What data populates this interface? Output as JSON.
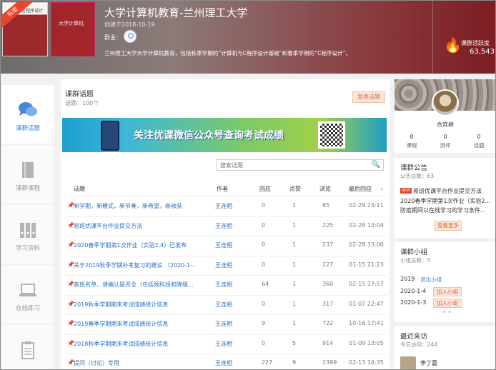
{
  "header": {
    "private_ribbon": "私密",
    "cover1_text": "高级语言程序设计",
    "cover2_text": "大学计算机",
    "course_title": "大学计算机教育-兰州理工大学",
    "created": "创建于2018-10-19",
    "owner_label": "群主：",
    "description": "兰州理工大学大学计算机教育，包括秋季学期的“计算机与C程序设计基础”和春季学期的“C程序设计”。",
    "activity_label": "课群活跃度",
    "activity_value": "63,543",
    "brand_colors": {
      "header_dark": "#7b1d22",
      "accent": "#3f82d6",
      "orange": "#e06c3c"
    }
  },
  "nav": {
    "items": [
      {
        "label": "课群话题",
        "icon": "chat-bubbles-icon",
        "active": true
      },
      {
        "label": "课群课程",
        "icon": "book-icon",
        "active": false
      },
      {
        "label": "学习资料",
        "icon": "binders-icon",
        "active": false
      },
      {
        "label": "在线练习",
        "icon": "laptop-icon",
        "active": false
      },
      {
        "label": "",
        "icon": "clipboard-icon",
        "active": false
      }
    ]
  },
  "topics": {
    "title": "课群话题",
    "count": "话题：100个",
    "post_button": "发表话题",
    "banner_text": "关注优课微信公众号查询考试成绩",
    "search_placeholder": "搜索话题",
    "columns": {
      "topic": "话题",
      "author": "作者",
      "replies": "回应",
      "likes": "点赞",
      "views": "浏览",
      "last_reply": "最后回应"
    },
    "rows": [
      {
        "title": "新学期，新模式，新节奏，新希望，新收获",
        "author": "王连相",
        "replies": "0",
        "likes": "1",
        "views": "65",
        "last": "02-29 23:11"
      },
      {
        "title": "易班优课平台作业提交方法",
        "author": "王连相",
        "replies": "0",
        "likes": "1",
        "views": "225",
        "last": "02-28 13:04"
      },
      {
        "title": "2020春季学期第1次作业（实验2.4）已发布",
        "author": "王连相",
        "replies": "0",
        "likes": "1",
        "views": "237",
        "last": "02-28 13:00"
      },
      {
        "title": "关于2019秋季学期补考复习的建议 （2020-1-...",
        "author": "王连相",
        "replies": "0",
        "likes": "1",
        "views": "227",
        "last": "01-15 21:23"
      },
      {
        "title": "各班名单，请确认是否全（包括预科班和降级...",
        "author": "王连相",
        "replies": "64",
        "likes": "1",
        "views": "360",
        "last": "02-15 17:57"
      },
      {
        "title": "2019秋季学期期末考试成绩统计信息",
        "author": "王连相",
        "replies": "0",
        "likes": "1",
        "views": "317",
        "last": "01-07 22:47"
      },
      {
        "title": "2019春季学期期末考试成绩统计信息",
        "author": "王连相",
        "replies": "9",
        "likes": "1",
        "views": "722",
        "last": "10-16 17:41"
      },
      {
        "title": "2018秋季学期期末考试成绩统计信息",
        "author": "王连相",
        "replies": "0",
        "likes": "5",
        "views": "914",
        "last": "01-09 13:05"
      },
      {
        "title": "提问（讨论）专用",
        "author": "王连相",
        "replies": "227",
        "likes": "9",
        "views": "2399",
        "last": "02-13 14:35"
      }
    ]
  },
  "profile": {
    "name": "合欢树",
    "stats": [
      {
        "value": "0",
        "label": "课程"
      },
      {
        "value": "0",
        "label": "测评"
      },
      {
        "value": "0",
        "label": "话题"
      }
    ]
  },
  "notice": {
    "title": "课群公告",
    "count": "公告总数：63",
    "new_badge": "NEW",
    "line1": "易班优课平台作业提交方法",
    "line2": "2020春季学期第1次作业（实验2...",
    "line3": "防疫期间以在线学习的学习条件...",
    "more": "查看更多"
  },
  "groups": {
    "title": "课群小组",
    "count": "小组总数：5",
    "items": [
      {
        "name": "2019",
        "action": "退出小组",
        "kind": "link"
      },
      {
        "name": "2020-1-4",
        "action": "加入小组",
        "kind": "button"
      },
      {
        "name": "2020-1-3",
        "action": "加入小组",
        "kind": "button"
      }
    ]
  },
  "visits": {
    "title": "最近来访",
    "count": "今日访问：244",
    "first_name": "李丁嘉"
  }
}
